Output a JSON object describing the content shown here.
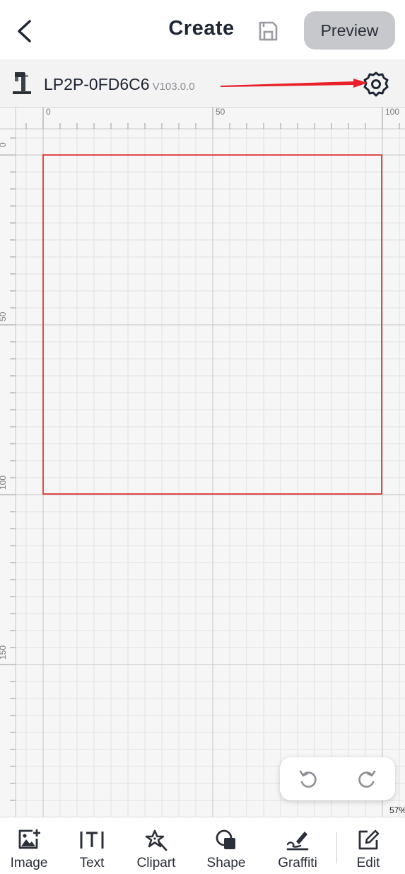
{
  "header": {
    "title": "Create",
    "preview_label": "Preview"
  },
  "device": {
    "name": "LP2P-0FD6C6",
    "version": "V103.0.0"
  },
  "canvas": {
    "ruler_top_labels": [
      "0",
      "50",
      "100"
    ],
    "ruler_left_labels": [
      "0",
      "50",
      "100",
      "150"
    ],
    "work_area_color": "#e02020",
    "annotation_arrow_color": "#e8202a",
    "zoom": "57%"
  },
  "toolbar": {
    "items": [
      {
        "label": "Image",
        "icon": "image-add-icon"
      },
      {
        "label": "Text",
        "icon": "text-icon"
      },
      {
        "label": "Clipart",
        "icon": "clipart-icon"
      },
      {
        "label": "Shape",
        "icon": "shape-icon"
      },
      {
        "label": "Graffiti",
        "icon": "graffiti-icon"
      },
      {
        "label": "Edit",
        "icon": "edit-icon"
      }
    ]
  }
}
